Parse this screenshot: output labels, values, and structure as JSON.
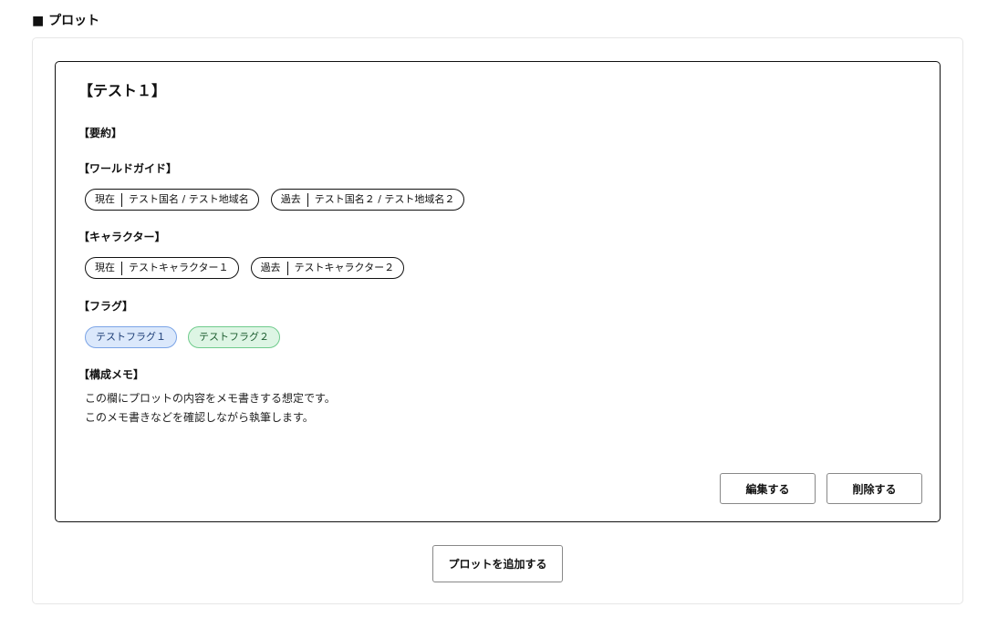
{
  "section": {
    "title": "■ プロット"
  },
  "plot": {
    "title": "【テスト１】",
    "summary": {
      "heading": "【要約】"
    },
    "world_guide": {
      "heading": "【ワールドガイド】",
      "chips": [
        {
          "tag": "現在",
          "label": "テスト国名 / テスト地域名"
        },
        {
          "tag": "過去",
          "label": "テスト国名２ / テスト地域名２"
        }
      ]
    },
    "characters": {
      "heading": "【キャラクター】",
      "chips": [
        {
          "tag": "現在",
          "label": "テストキャラクター１"
        },
        {
          "tag": "過去",
          "label": "テストキャラクター２"
        }
      ]
    },
    "flags": {
      "heading": "【フラグ】",
      "chips": [
        {
          "label": "テストフラグ１",
          "color": "#dbe8fb"
        },
        {
          "label": "テストフラグ２",
          "color": "#ddf5e4"
        }
      ]
    },
    "memo": {
      "heading": "【構成メモ】",
      "lines": [
        "この欄にプロットの内容をメモ書きする想定です。",
        "このメモ書きなどを確認しながら執筆します。"
      ]
    },
    "actions": {
      "edit_label": "編集する",
      "delete_label": "削除する"
    }
  },
  "add_plot_label": "プロットを追加する"
}
